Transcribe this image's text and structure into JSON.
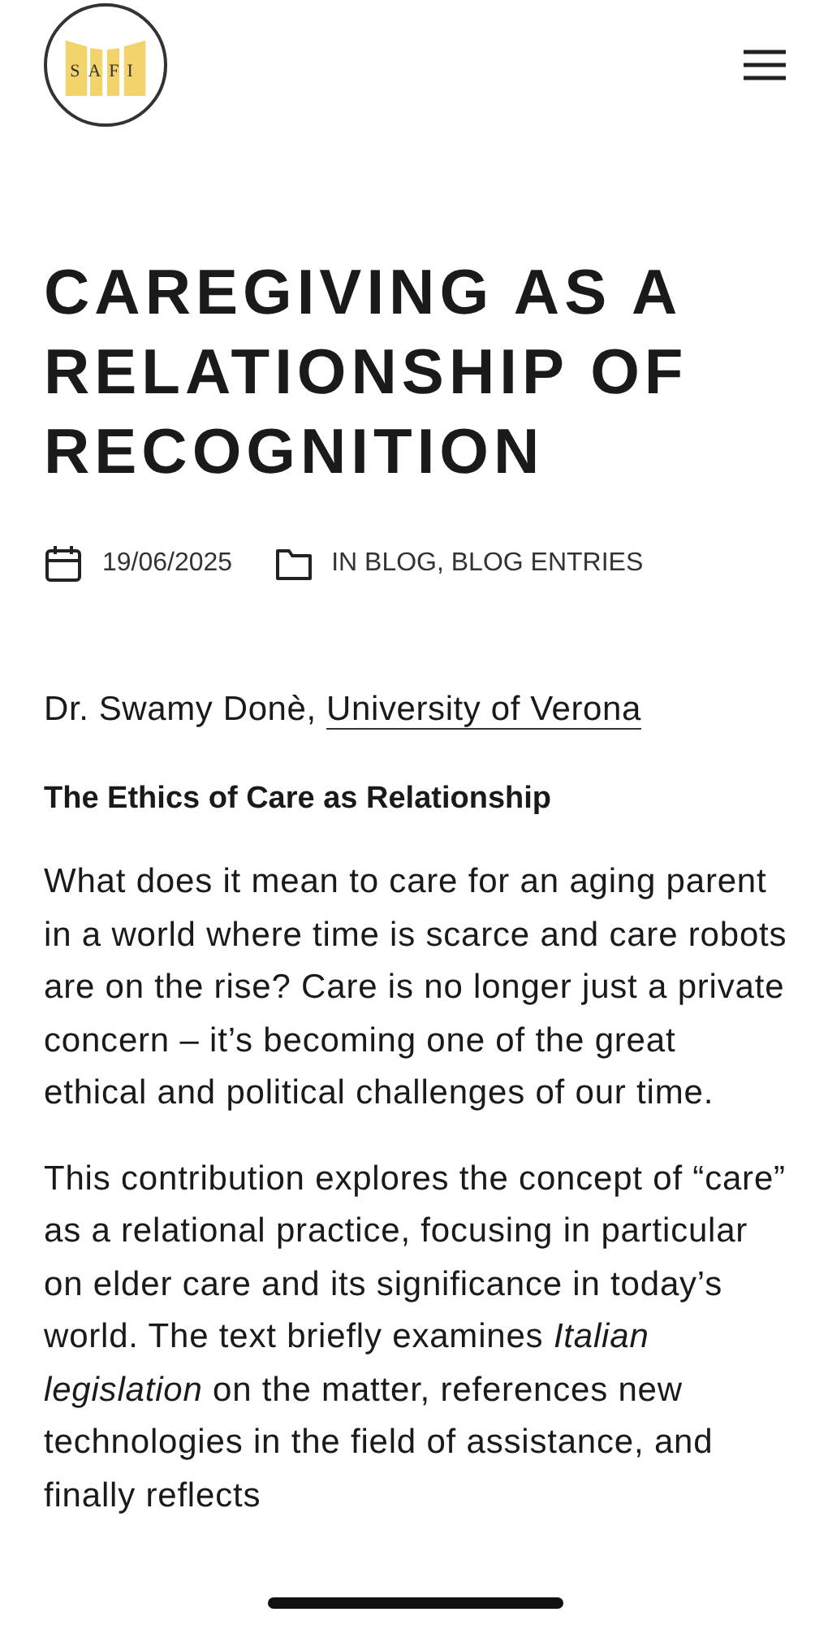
{
  "header": {
    "logo_text": "SAFI"
  },
  "article": {
    "title": "CAREGIVING AS A RELATIONSHIP OF RECOGNITION",
    "date": "19/06/2025",
    "categories": "IN BLOG, BLOG ENTRIES",
    "author": "Dr. Swamy Donè,",
    "affiliation": "University of Verona",
    "heading": "The Ethics of Care as Relationship",
    "paragraphs": [
      "What does it mean to care for an aging parent in a world where time is scarce and care robots are on the rise? Care is no longer just a private concern – it’s becoming one of the great ethical and political challenges of our time.",
      "This contribution explores the concept of “care” as a relational practice, focusing in particular on elder care and its significance in today’s world. The text briefly examines *Italian legislation* on the matter, references new technologies in the field of assistance, and finally reflects"
    ]
  }
}
